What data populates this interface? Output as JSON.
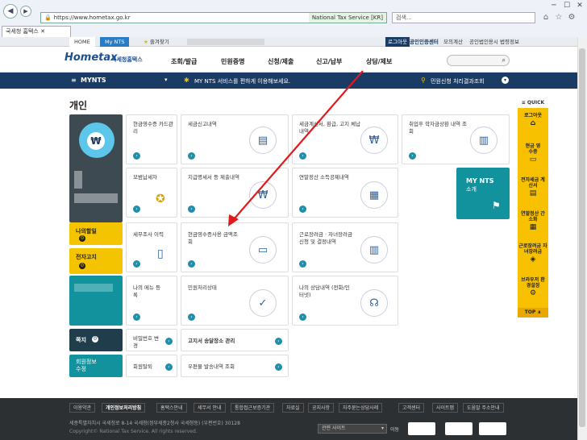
{
  "browser": {
    "url": "https://www.hometax.go.kr",
    "cert": "National Tax Service [KR]",
    "search_placeholder": "검색...",
    "tab_title": "국세청 홈택스"
  },
  "site_bar": {
    "home": "HOME",
    "mynts": "My NTS",
    "favorites": "즐겨찾기",
    "login": "로그아웃",
    "cert_center": "공인인증센터",
    "mock_calc": "모의계산",
    "corp_cert": "공인법인용시",
    "law_info": "법령정보"
  },
  "header": {
    "logo_main": "Hometax",
    "logo_sub": "국세청홈택스",
    "menus": [
      "조회/발급",
      "민원증명",
      "신청/제출",
      "신고/납부",
      "상담/제보"
    ]
  },
  "mynts_bar": {
    "label": "MYNTS",
    "notice": "MY NTS 서비스를 편하게 이용해보세요.",
    "right_link": "민원신청 처리결과조회"
  },
  "section_title": "개인",
  "left": {
    "my_work": "나의할일",
    "e_notice": "전자고지",
    "gift": "쪽지",
    "member_info": "회원정보 수정",
    "password_change": "비밀번호 변경",
    "withdraw": "회원탈퇴"
  },
  "cards": {
    "c1": "현금영수증 카드관리",
    "c2": "세금신고내역",
    "c3": "세금계산서, 환급, 고지 체납내역",
    "c4": "취업후 학자금상환 내역 조회",
    "c5": "모범납세자",
    "c6": "지급명세서 등 제출내역",
    "c7": "연말정산 소득공제내역",
    "c8_title": "MY NTS",
    "c8_sub": "소개",
    "c9": "세무조사 이력",
    "c10": "현금영수증사용 금액조회",
    "c11": "근로장려금 · 자녀장려금 신청 및 결정내역",
    "c12": "나의 메뉴 등록",
    "c13": "민원처리상태",
    "c14": "나의 상담내역 (전화/인터넷)",
    "c15": "고지서 송달장소 관리",
    "c16": "우편물 발송내역 조회"
  },
  "quick": {
    "title": "QUICK",
    "items": [
      "로그아웃",
      "현금 영수증",
      "전자세금 계산서",
      "연말정산 간소화",
      "근로장려금 자녀장려금",
      "브라우저 환경설정"
    ],
    "top": "TOP ∧"
  },
  "footer": {
    "links": [
      "이용약관",
      "개인정보처리방침",
      "홈택스안내",
      "세무서 안내",
      "통합접근보증기관",
      "자료실",
      "공지사항",
      "자주묻는상담사례",
      "고객센터",
      "사이트맵",
      "도움말 주소안내"
    ],
    "address": "세종특별자치시 국세청로 8-14 국세청(정부세종2청사 국세청동) (우편번호) 30128",
    "copyright": "Copyright© National Tax Service. All rights reserved.",
    "related": "관련 사이트",
    "go": "이동"
  },
  "colors": {
    "navy": "#1a3b64",
    "teal": "#12929c",
    "yellow": "#f5c400",
    "arrow": "#e0191d"
  }
}
